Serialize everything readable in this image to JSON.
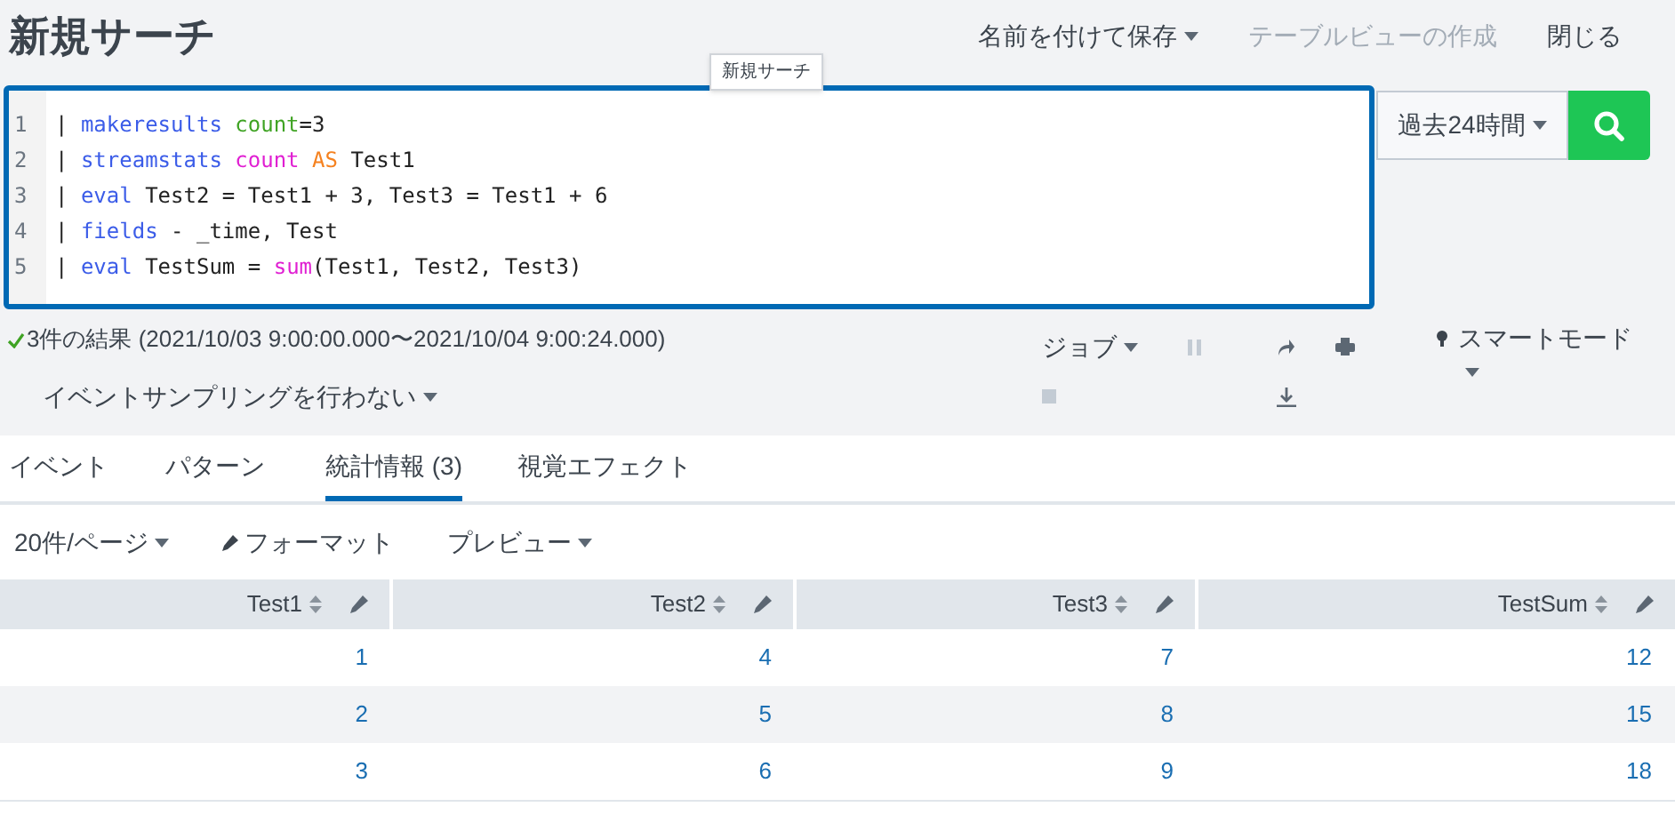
{
  "title": "新規サーチ",
  "header_actions": [
    {
      "label": "名前を付けて保存",
      "dropdown": true,
      "disabled": false
    },
    {
      "label": "テーブルビューの作成",
      "dropdown": false,
      "disabled": true
    },
    {
      "label": "閉じる",
      "dropdown": false,
      "disabled": false
    }
  ],
  "tooltip": "新規サーチ",
  "editor": {
    "lines": [
      [
        {
          "text": "| ",
          "kind": "plain"
        },
        {
          "text": "makeresults",
          "kind": "command"
        },
        {
          "text": " count",
          "kind": "argument"
        },
        {
          "text": "=3",
          "kind": "plain"
        }
      ],
      [
        {
          "text": "| ",
          "kind": "plain"
        },
        {
          "text": "streamstats",
          "kind": "command"
        },
        {
          "text": " count",
          "kind": "function"
        },
        {
          "text": " AS",
          "kind": "keyword"
        },
        {
          "text": " Test1",
          "kind": "plain"
        }
      ],
      [
        {
          "text": "| ",
          "kind": "plain"
        },
        {
          "text": "eval",
          "kind": "command"
        },
        {
          "text": " Test2 = Test1 + 3, Test3 = Test1 + 6",
          "kind": "plain"
        }
      ],
      [
        {
          "text": "| ",
          "kind": "plain"
        },
        {
          "text": "fields",
          "kind": "command"
        },
        {
          "text": " - _time, Test",
          "kind": "plain"
        }
      ],
      [
        {
          "text": "| ",
          "kind": "plain"
        },
        {
          "text": "eval",
          "kind": "command"
        },
        {
          "text": " TestSum = ",
          "kind": "plain"
        },
        {
          "text": "sum",
          "kind": "function"
        },
        {
          "text": "(Test1, Test2, Test3",
          "kind": "plain"
        },
        {
          "text": ")",
          "kind": "plain"
        }
      ]
    ],
    "line_numbers": [
      "1",
      "2",
      "3",
      "4",
      "5"
    ]
  },
  "time_range": "過去24時間",
  "results_summary": "3件の結果 (2021/10/03 9:00:00.000〜2021/10/04 9:00:24.000)",
  "sampling": "イベントサンプリングを行わない",
  "job": "ジョブ",
  "job_controls": [
    {
      "kind": "pause",
      "disabled": true
    },
    {
      "kind": "share",
      "disabled": false
    },
    {
      "kind": "print",
      "disabled": false
    },
    {
      "kind": "stop",
      "disabled": true
    },
    {
      "kind": "download",
      "disabled": false
    }
  ],
  "search_mode": "スマートモード",
  "tabs": [
    {
      "label": "イベント",
      "selected": false
    },
    {
      "label": "パターン",
      "selected": false
    },
    {
      "label": "統計情報 (3)",
      "selected": true
    },
    {
      "label": "視覚エフェクト",
      "selected": false
    }
  ],
  "table_toolbar": {
    "per_page": "20件/ページ",
    "format": "フォーマット",
    "preview": "プレビュー"
  },
  "table": {
    "columns": [
      "Test1",
      "Test2",
      "Test3",
      "TestSum"
    ],
    "rows": [
      [
        "1",
        "4",
        "7",
        "12"
      ],
      [
        "2",
        "5",
        "8",
        "15"
      ],
      [
        "3",
        "6",
        "9",
        "18"
      ]
    ]
  }
}
